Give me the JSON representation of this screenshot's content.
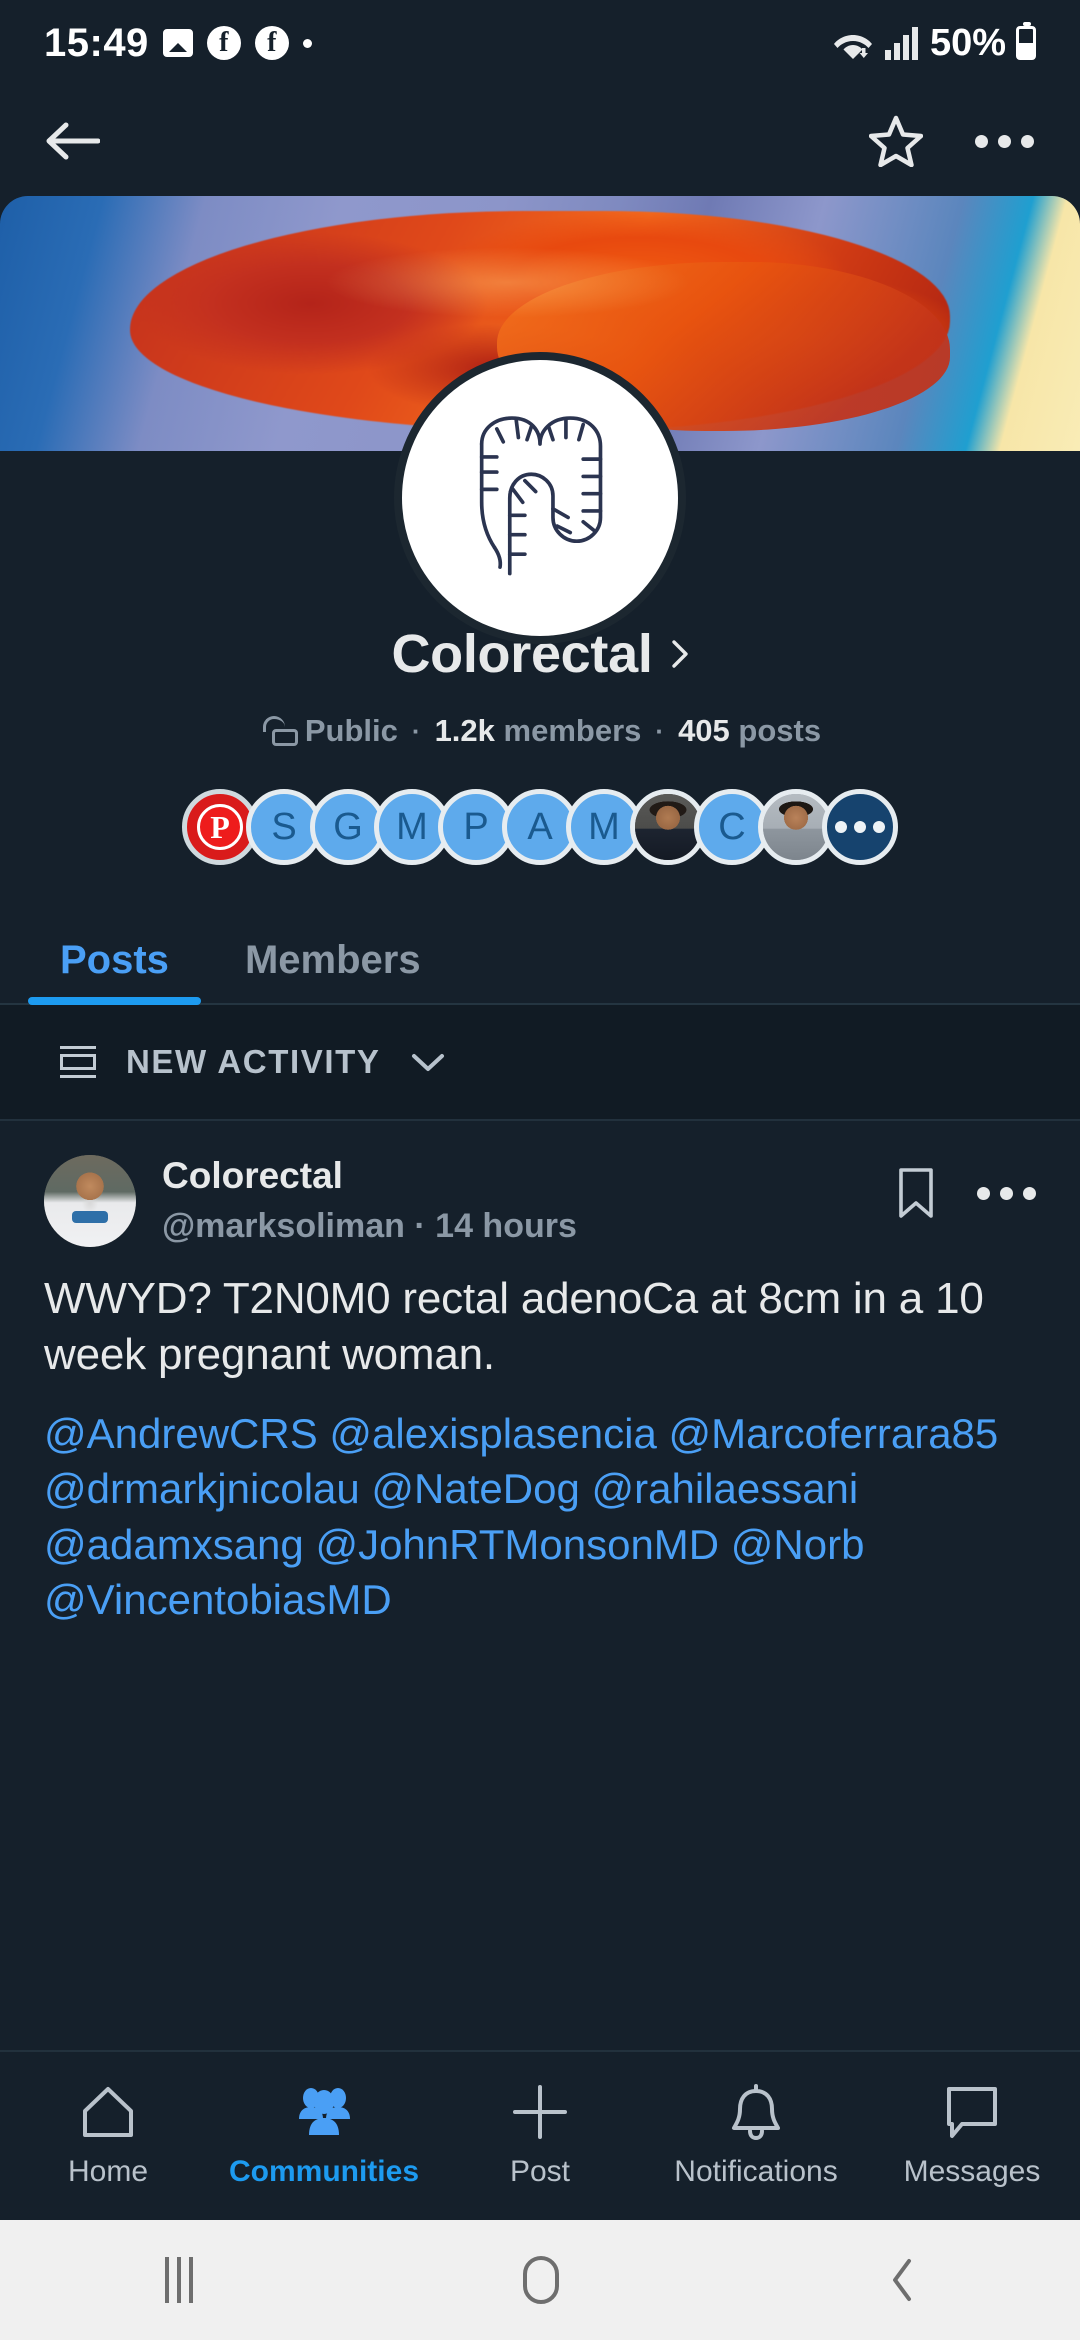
{
  "statusbar": {
    "time": "15:49",
    "battery_percent": "50%",
    "icons": [
      "image-icon",
      "facebook-icon",
      "facebook-icon",
      "dot-icon",
      "wifi-icon",
      "cellular-signal-icon",
      "battery-icon"
    ]
  },
  "appbar": {
    "back_icon": "back-arrow-icon",
    "star_icon": "star-icon",
    "overflow_icon": "more-horizontal-icon"
  },
  "profile": {
    "banner_alt": "surgical-specimen-photo",
    "avatar_alt": "colon-line-drawing",
    "name": "Colorectal",
    "chevron": "chevron-right-icon",
    "privacy": "Public",
    "members": "1.2k",
    "members_label": "members",
    "posts": "405",
    "posts_label": "posts",
    "separator": "·"
  },
  "facepile": [
    {
      "type": "mark",
      "label": "P",
      "color": "#ee1c1c"
    },
    {
      "type": "letter",
      "label": "S",
      "color": "#5eaaec"
    },
    {
      "type": "letter",
      "label": "G",
      "color": "#5eaaec"
    },
    {
      "type": "letter",
      "label": "M",
      "color": "#5eaaec"
    },
    {
      "type": "letter",
      "label": "P",
      "color": "#5eaaec"
    },
    {
      "type": "letter",
      "label": "A",
      "color": "#5eaaec"
    },
    {
      "type": "letter",
      "label": "M",
      "color": "#5eaaec"
    },
    {
      "type": "photo",
      "label": "",
      "color": "#4a4a48"
    },
    {
      "type": "letter",
      "label": "C",
      "color": "#5eaaec"
    },
    {
      "type": "photo",
      "label": "",
      "color": "#9aa1a8"
    },
    {
      "type": "more",
      "label": "",
      "color": "#16436e"
    }
  ],
  "tabs": [
    {
      "label": "Posts",
      "active": true
    },
    {
      "label": "Members",
      "active": false
    }
  ],
  "activity": {
    "icon": "list-view-icon",
    "label": "NEW ACTIVITY",
    "chevron": "chevron-down-icon"
  },
  "post": {
    "author_avatar_alt": "author-profile-photo",
    "author_name": "Colorectal",
    "handle": "@marksoliman",
    "separator": "·",
    "timestamp": "14 hours",
    "bookmark_icon": "bookmark-icon",
    "overflow_icon": "more-horizontal-icon",
    "body": "WWYD? T2N0M0 rectal adenoCa at 8cm in a 10 week pregnant woman.",
    "mentions": "@AndrewCRS @alexisplasencia @Marcoferrara85 @drmarkjnicolau @NateDog @rahilaessani @adamxsang @JohnRTMonsonMD @Norb @VincentobiasMD"
  },
  "bottomnav": [
    {
      "label": "Home",
      "icon": "home-icon",
      "active": false
    },
    {
      "label": "Communities",
      "icon": "communities-icon",
      "active": true
    },
    {
      "label": "Post",
      "icon": "plus-icon",
      "active": false
    },
    {
      "label": "Notifications",
      "icon": "bell-icon",
      "active": false
    },
    {
      "label": "Messages",
      "icon": "message-icon",
      "active": false
    }
  ],
  "sysnav": {
    "recents": "recents-icon",
    "home": "home-pill-icon",
    "back": "back-chevron-icon"
  },
  "colors": {
    "background": "#15202b",
    "accent": "#1d9bf0",
    "link": "#4a9ff5",
    "muted": "#8b98a5",
    "text": "#e7e9ea"
  }
}
